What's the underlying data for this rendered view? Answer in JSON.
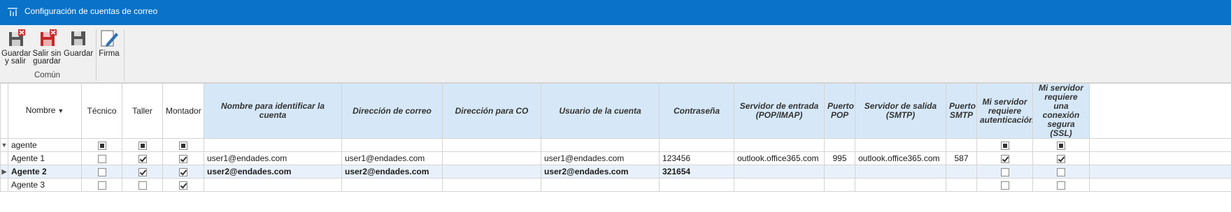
{
  "window": {
    "title": "Configuración de cuentas de correo",
    "icon": "app-chart-icon"
  },
  "ribbon": {
    "buttons": [
      {
        "label": "Guardar\ny salir",
        "icon": "save-close-icon"
      },
      {
        "label": "Salir sin\nguardar",
        "icon": "exit-no-save-icon"
      },
      {
        "label": "Guardar",
        "icon": "save-icon"
      },
      {
        "label": "Firma",
        "icon": "signature-icon"
      }
    ],
    "group_label": "Común"
  },
  "grid": {
    "columns": [
      "Nombre",
      "Técnico",
      "Taller",
      "Montador",
      "Nombre para identificar la cuenta",
      "Dirección de correo",
      "Dirección para CO",
      "Usuario de la cuenta",
      "Contraseña",
      "Servidor de entrada (POP/IMAP)",
      "Puerto POP",
      "Servidor de salida (SMTP)",
      "Puerto SMTP",
      "Mi servidor requiere autenticación",
      "Mi servidor requiere una conexión segura (SSL)"
    ],
    "filter_row": {
      "nombre": "agente"
    },
    "rows": [
      {
        "nombre": "Agente 1",
        "tecnico": false,
        "taller": true,
        "montador": true,
        "cuenta": "user1@endades.com",
        "correo": "user1@endades.com",
        "co": "",
        "usuario": "user1@endades.com",
        "contrasena": "123456",
        "entrada": "outlook.office365.com",
        "pop": "995",
        "salida": "outlook.office365.com",
        "smtp": "587",
        "auth": true,
        "ssl": true
      },
      {
        "nombre": "Agente 2",
        "tecnico": false,
        "taller": true,
        "montador": true,
        "cuenta": "user2@endades.com",
        "correo": "user2@endades.com",
        "co": "",
        "usuario": "user2@endades.com",
        "contrasena": "321654",
        "entrada": "",
        "pop": "",
        "salida": "",
        "smtp": "",
        "auth": false,
        "ssl": false
      },
      {
        "nombre": "Agente 3",
        "tecnico": false,
        "taller": false,
        "montador": true,
        "cuenta": "",
        "correo": "",
        "co": "",
        "usuario": "",
        "contrasena": "",
        "entrada": "",
        "pop": "",
        "salida": "",
        "smtp": "",
        "auth": false,
        "ssl": false
      }
    ]
  },
  "colors": {
    "titlebar": "#0a72c9",
    "ribbon": "#f0f0f0",
    "editable_header": "#d6e8f8",
    "selected_row": "#e8f1fb"
  }
}
